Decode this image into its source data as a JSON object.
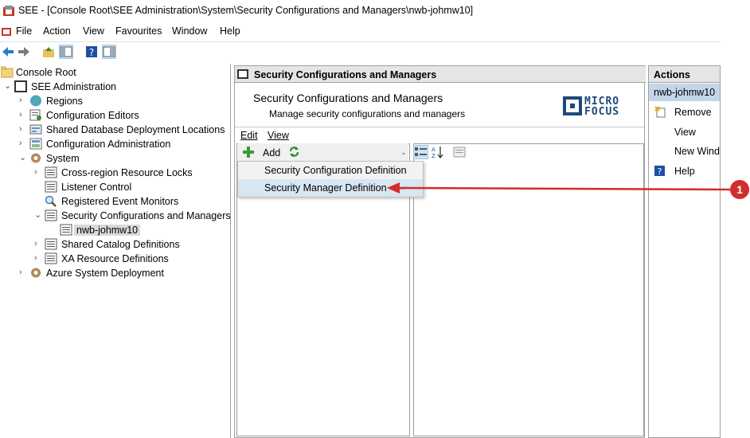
{
  "window": {
    "title": "SEE - [Console Root\\SEE Administration\\System\\Security Configurations and Managers\\nwb-johmw10]"
  },
  "menubar": [
    "File",
    "Action",
    "View",
    "Favourites",
    "Window",
    "Help"
  ],
  "toolbar": {
    "buttons": [
      "back-icon",
      "forward-icon",
      "up-folder-icon",
      "show-hide-tree-icon",
      "help-icon",
      "action-pane-icon"
    ]
  },
  "tree": {
    "nodes": [
      {
        "label": "Console Root",
        "icon": "folder-icon",
        "level": 0,
        "chevron": ""
      },
      {
        "label": "SEE Administration",
        "icon": "console-icon",
        "level": 0,
        "chevron": "expanded"
      },
      {
        "label": "Regions",
        "icon": "globe-icon",
        "level": 1,
        "chevron": "collapsed"
      },
      {
        "label": "Configuration Editors",
        "icon": "editor-icon",
        "level": 1,
        "chevron": "collapsed"
      },
      {
        "label": "Shared Database Deployment Locations",
        "icon": "database-icon",
        "level": 1,
        "chevron": "collapsed"
      },
      {
        "label": "Configuration Administration",
        "icon": "config-icon",
        "level": 1,
        "chevron": "collapsed"
      },
      {
        "label": "System",
        "icon": "gear-icon",
        "level": 1,
        "chevron": "expanded"
      },
      {
        "label": "Cross-region Resource Locks",
        "icon": "list-icon",
        "level": 2,
        "chevron": "collapsed"
      },
      {
        "label": "Listener Control",
        "icon": "list-icon",
        "level": 2,
        "chevron": ""
      },
      {
        "label": "Registered Event Monitors",
        "icon": "magnifier-icon",
        "level": 2,
        "chevron": ""
      },
      {
        "label": "Security Configurations and Managers",
        "icon": "list-icon",
        "level": 2,
        "chevron": "expanded"
      },
      {
        "label": "nwb-johmw10",
        "icon": "list-icon",
        "level": 3,
        "chevron": "",
        "selected": true
      },
      {
        "label": "Shared Catalog Definitions",
        "icon": "list-icon",
        "level": 2,
        "chevron": "collapsed"
      },
      {
        "label": "XA Resource Definitions",
        "icon": "list-icon",
        "level": 2,
        "chevron": "collapsed"
      },
      {
        "label": "Azure System Deployment",
        "icon": "gear-icon",
        "level": 1,
        "chevron": "collapsed"
      }
    ]
  },
  "middle": {
    "header": "Security Configurations and Managers",
    "banner_title": "Security Configurations and Managers",
    "banner_subtitle": "Manage security configurations and managers",
    "logo_line1": "MICRO",
    "logo_line2": "FOCUS",
    "edit_menu": [
      "Edit",
      "View"
    ],
    "add_label": "Add",
    "dropdown_items": [
      "Security Configuration Definition",
      "Security Manager Definition"
    ]
  },
  "actions": {
    "header": "Actions",
    "selected": "nwb-johmw10",
    "items": [
      {
        "label": "Remove",
        "icon": "remove-icon"
      },
      {
        "label": "View",
        "icon": ""
      },
      {
        "label": "New Windo",
        "icon": ""
      },
      {
        "label": "Help",
        "icon": "help-icon"
      }
    ]
  },
  "callout": {
    "number": "1",
    "color": "#d22c2c"
  }
}
